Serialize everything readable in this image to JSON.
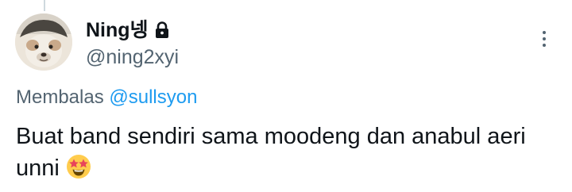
{
  "tweet": {
    "author": {
      "display_name": "Ning넹",
      "handle": "@ning2xyi",
      "avatar_icon": "avatar-image",
      "protected_icon": "lock-icon"
    },
    "reply_context": {
      "prefix": "Membalas",
      "mention": "@sullsyon"
    },
    "text": "Buat band sendiri sama moodeng dan anabul aeri unni",
    "emoji": "star-struck-emoji",
    "menu_icon": "more-options-icon"
  },
  "colors": {
    "text_primary": "#0f1419",
    "text_secondary": "#536471",
    "mention": "#1d9bf0",
    "thread_line": "#cfd9de"
  }
}
